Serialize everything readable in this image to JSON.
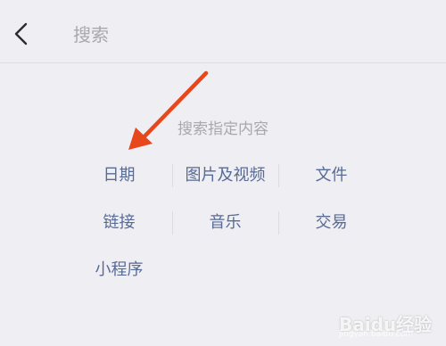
{
  "header": {
    "back_icon": "chevron-left-icon",
    "search_placeholder": "搜索"
  },
  "hint": "搜索指定内容",
  "categories": [
    "日期",
    "图片及视频",
    "文件",
    "链接",
    "音乐",
    "交易",
    "小程序"
  ],
  "colors": {
    "background": "#efeef3",
    "link": "#576b95",
    "hint": "#a8a8ad",
    "arrow": "#e8471c"
  },
  "watermark": {
    "brand": "Baidu经验",
    "url": "jingyan.baidu.com"
  }
}
